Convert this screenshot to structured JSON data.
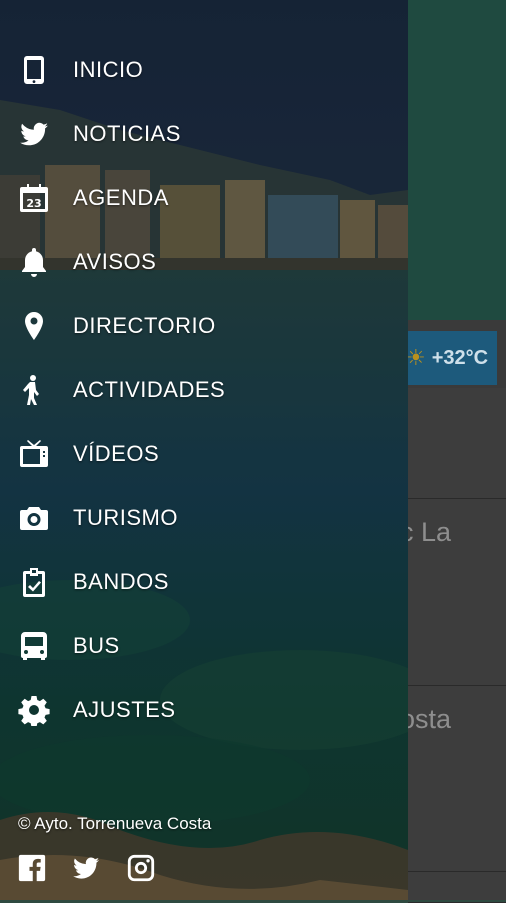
{
  "app": {
    "weather": {
      "icon": "sun-icon",
      "temperature": "+32°C"
    },
    "cards": [
      {
        "text": "c La"
      },
      {
        "text": "osta"
      }
    ]
  },
  "menu": {
    "items": [
      {
        "label": "INICIO",
        "icon": "phone-icon"
      },
      {
        "label": "NOTICIAS",
        "icon": "twitter-icon"
      },
      {
        "label": "AGENDA",
        "icon": "calendar-icon",
        "icon_text": "23"
      },
      {
        "label": "AVISOS",
        "icon": "bell-icon"
      },
      {
        "label": "DIRECTORIO",
        "icon": "map-pin-icon"
      },
      {
        "label": "ACTIVIDADES",
        "icon": "activity-person-icon"
      },
      {
        "label": "VÍDEOS",
        "icon": "tv-icon"
      },
      {
        "label": "TURISMO",
        "icon": "camera-icon"
      },
      {
        "label": "BANDOS",
        "icon": "clipboard-check-icon"
      },
      {
        "label": "BUS",
        "icon": "bus-icon"
      },
      {
        "label": "AJUSTES",
        "icon": "gear-icon"
      }
    ]
  },
  "footer": {
    "copyright": "© Ayto. Torrenueva Costa",
    "social": [
      "facebook-icon",
      "twitter-icon",
      "instagram-icon"
    ]
  },
  "colors": {
    "drawer_text": "#ffffff",
    "weather_bg": "#1d5a7c",
    "header_bg": "#1f4a40"
  }
}
